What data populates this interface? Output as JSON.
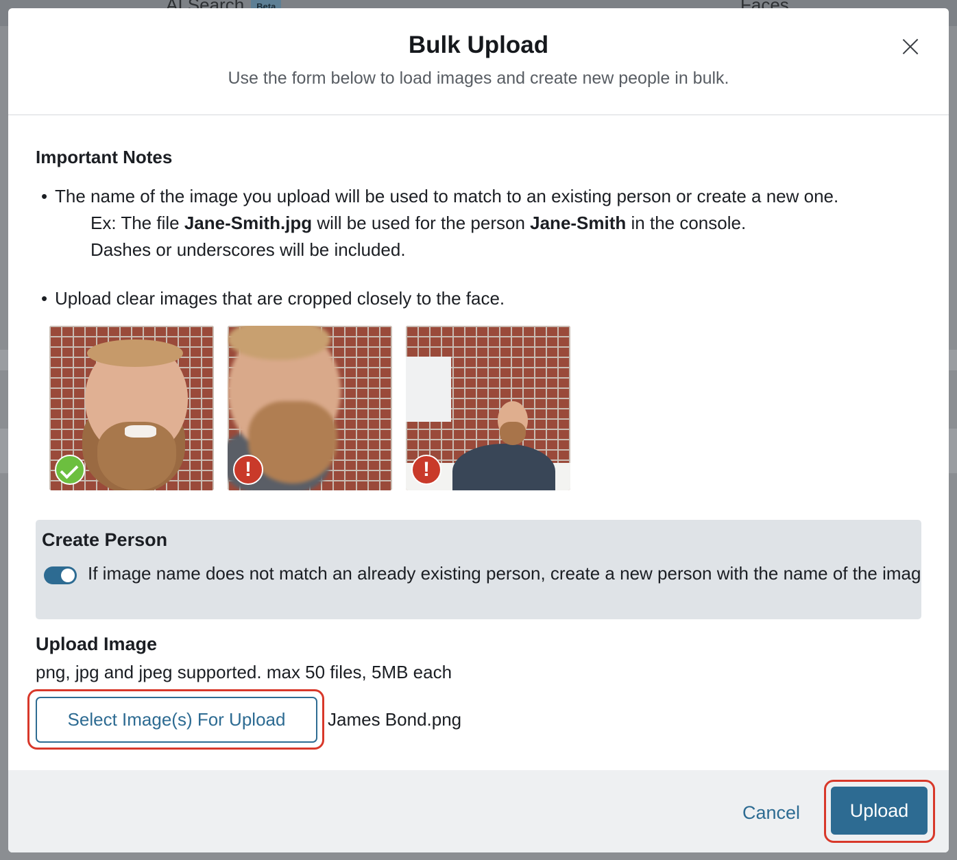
{
  "background": {
    "tabs": [
      {
        "label": "AI Search",
        "badge": "Beta"
      },
      {
        "label": "Faces"
      }
    ]
  },
  "modal": {
    "title": "Bulk Upload",
    "subtitle": "Use the form below to load images and create new people in bulk.",
    "close_icon": "close-icon"
  },
  "notes": {
    "heading": "Important Notes",
    "bullet1": "The name of the image you upload will be used to match to an existing person or create a new one.",
    "example_prefix": "Ex: The file ",
    "example_file": "Jane-Smith.jpg",
    "example_middle": " will be used for the person ",
    "example_person": "Jane-Smith",
    "example_suffix": " in the console.",
    "dashes": "Dashes or underscores will be included.",
    "bullet2": "Upload clear images that are cropped closely to the face.",
    "examples": [
      {
        "status": "good",
        "icon": "checkmark-icon"
      },
      {
        "status": "bad",
        "icon": "exclamation-icon",
        "symbol": "!"
      },
      {
        "status": "bad",
        "icon": "exclamation-icon",
        "symbol": "!"
      }
    ]
  },
  "create_person": {
    "title": "Create Person",
    "enabled": true,
    "label": "If image name does not match an already existing person, create a new person with the name of the image."
  },
  "upload": {
    "heading": "Upload Image",
    "hint": "png, jpg and jpeg supported. max 50 files, 5MB each",
    "select_label": "Select Image(s) For Upload",
    "selected_file": "James Bond.png"
  },
  "footer": {
    "cancel_label": "Cancel",
    "upload_label": "Upload"
  },
  "colors": {
    "accent": "#2d6b92",
    "highlight": "#d8382a",
    "ok": "#6cbf3f",
    "error": "#c93a2a"
  }
}
